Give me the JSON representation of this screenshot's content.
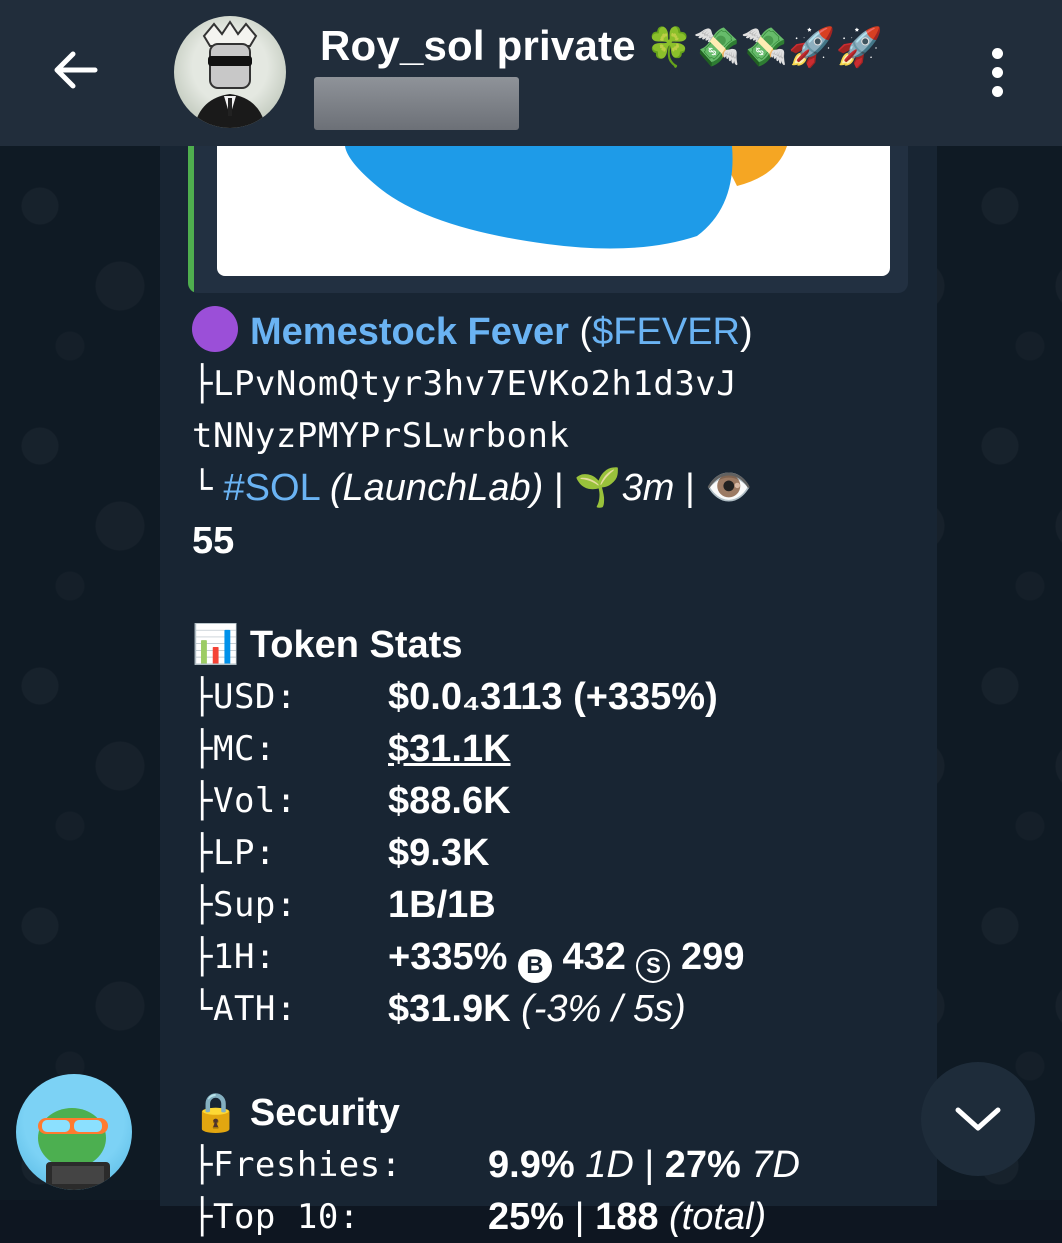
{
  "header": {
    "title": "Roy_sol private",
    "title_emojis": "🍀💸💸🚀🚀",
    "back_icon": "arrow-left-icon",
    "menu_icon": "more-vertical-icon"
  },
  "message": {
    "token_dot": "🟣",
    "token_name": "Memestock Fever",
    "ticker_open": "(",
    "ticker": "$FEVER",
    "ticker_close": ")",
    "address_prefix": "├",
    "address_line1": "LPvNomQtyr3hv7EVKo2h1d3vJ",
    "address_line2": "tNNyzPMYPrSLwrbonk",
    "chain_prefix": "└",
    "chain_tag": "#SOL",
    "platform": "(LaunchLab)",
    "sep1": "|",
    "age_emoji": "🌱",
    "age": "3m",
    "sep2": "|",
    "views_emoji": "👁️",
    "views": "55",
    "stats_emoji": "📊",
    "stats_title": "Token Stats",
    "stats": [
      {
        "prefix": "├",
        "label": "USD:",
        "value": "$0.0₄3113 (+335%)"
      },
      {
        "prefix": "├",
        "label": "MC:",
        "value": "$31.1K"
      },
      {
        "prefix": "├",
        "label": "Vol:",
        "value": "$88.6K"
      },
      {
        "prefix": "├",
        "label": "LP:",
        "value": "$9.3K"
      },
      {
        "prefix": "├",
        "label": "Sup:",
        "value": "1B/1B"
      },
      {
        "prefix": "├",
        "label": "1H:",
        "value": "+335%",
        "buys_icon": "B",
        "buys": "432",
        "sells_icon": "S",
        "sells": "299"
      },
      {
        "prefix": "└",
        "label": "ATH:",
        "value": "$31.9K",
        "ath_note": "(-3% / 5s)"
      }
    ],
    "security_emoji": "🔒",
    "security_title": "Security",
    "security": [
      {
        "prefix": "├",
        "label": "Freshies:",
        "v1": "9.9%",
        "p1": "1D",
        "sep": "|",
        "v2": "27%",
        "p2": "7D"
      },
      {
        "prefix": "├",
        "label": "Top 10:",
        "v1": "25%",
        "sep": "|",
        "v2": "188",
        "p2": "(total)"
      }
    ]
  },
  "colors": {
    "header_bg": "#212d3b",
    "bubble_bg": "#182533",
    "link": "#6ab3f3",
    "preview_bar": "#4fae4e"
  },
  "icons": {
    "scroll_down": "chevron-down-icon"
  }
}
